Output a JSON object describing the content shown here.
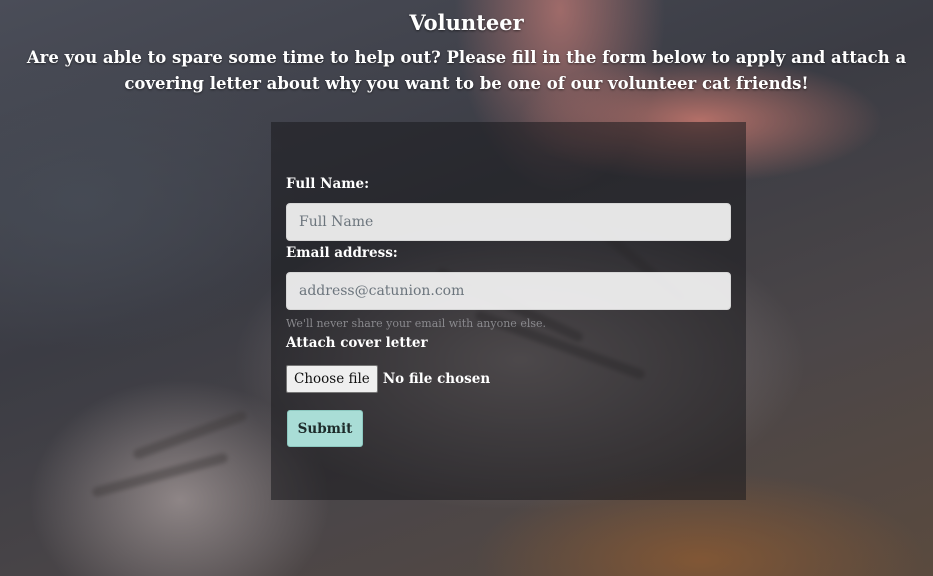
{
  "page": {
    "title": "Volunteer",
    "intro": "Are you able to spare some time to help out? Please fill in the form below to apply and attach a covering letter about why you want to be one of our volunteer cat friends!"
  },
  "form": {
    "full_name": {
      "label": "Full Name:",
      "placeholder": "Full Name",
      "value": ""
    },
    "email": {
      "label": "Email address:",
      "placeholder": "address@catunion.com",
      "value": "",
      "help": "We'll never share your email with anyone else."
    },
    "cover_letter": {
      "label": "Attach cover letter",
      "button_label": "Choose file",
      "status": "No file chosen"
    },
    "submit_label": "Submit"
  },
  "colors": {
    "submit_background": "#a9ddd6",
    "panel_background": "rgba(25,25,30,0.55)"
  }
}
